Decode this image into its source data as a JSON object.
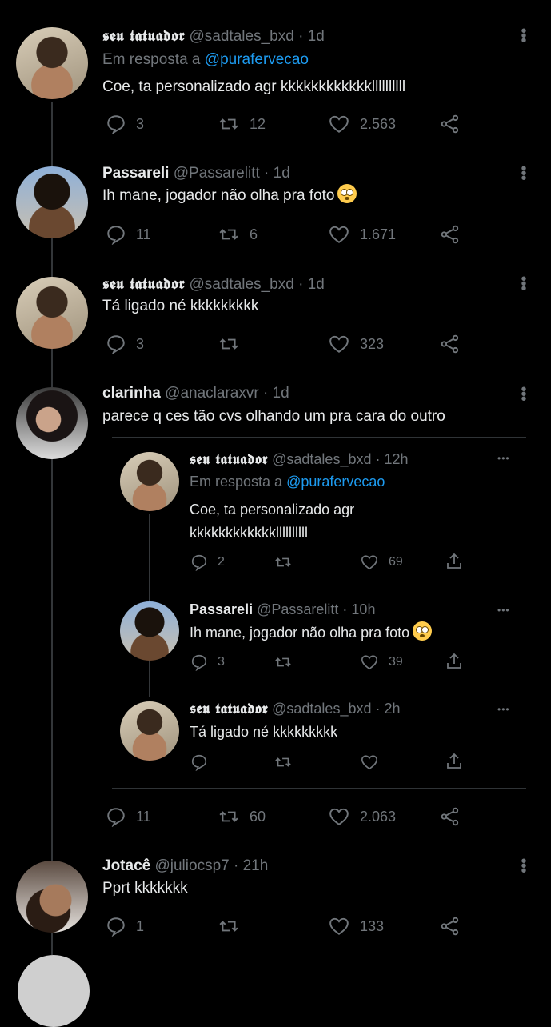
{
  "colors": {
    "background": "#000000",
    "text": "#e7e9ea",
    "muted": "#71767b",
    "link": "#1d9bf0"
  },
  "tweets": [
    {
      "name": "𝖘𝖊𝖚 𝖙𝖆𝖙𝖚𝖆𝖉𝖔𝖗",
      "handle": "@sadtales_bxd",
      "time": "· 1d",
      "reply_prefix": "Em resposta a",
      "reply_to": "@purafervecao",
      "text": "Coe, ta personalizado agr kkkkkkkkkkkkllllllllll",
      "replies": "3",
      "retweets": "12",
      "likes": "2.563"
    },
    {
      "name": "Passareli",
      "handle": "@Passarelitt",
      "time": "· 1d",
      "text": "Ih mane, jogador não olha pra foto",
      "emoji": "flushed-face",
      "replies": "11",
      "retweets": "6",
      "likes": "1.671"
    },
    {
      "name": "𝖘𝖊𝖚 𝖙𝖆𝖙𝖚𝖆𝖉𝖔𝖗",
      "handle": "@sadtales_bxd",
      "time": "· 1d",
      "text": "Tá ligado né kkkkkkkkk",
      "replies": "3",
      "retweets": "",
      "likes": "323"
    },
    {
      "name": "clarinha",
      "handle": "@anaclaraxvr",
      "time": "· 1d",
      "text": "parece q ces tão cvs olhando um pra cara do outro",
      "replies": "11",
      "retweets": "60",
      "likes": "2.063"
    },
    {
      "name": "Jotacê",
      "handle": "@juliocsp7",
      "time": "· 21h",
      "text": "Pprt kkkkkkk",
      "replies": "1",
      "retweets": "",
      "likes": "133"
    }
  ],
  "quoted": [
    {
      "name": "𝖘𝖊𝖚 𝖙𝖆𝖙𝖚𝖆𝖉𝖔𝖗",
      "handle": "@sadtales_bxd",
      "time": "· 12h",
      "reply_prefix": "Em resposta a",
      "reply_to": "@purafervecao",
      "text_line1": "Coe, ta personalizado agr",
      "text_line2": "kkkkkkkkkkkkllllllllll",
      "replies": "2",
      "likes": "69"
    },
    {
      "name": "Passareli",
      "handle": "@Passarelitt",
      "time": "· 10h",
      "text": "Ih mane, jogador não olha pra foto",
      "emoji": "flushed-face",
      "replies": "3",
      "likes": "39"
    },
    {
      "name": "𝖘𝖊𝖚 𝖙𝖆𝖙𝖚𝖆𝖉𝖔𝖗",
      "handle": "@sadtales_bxd",
      "time": "· 2h",
      "text": "Tá ligado né kkkkkkkkk",
      "replies": "",
      "likes": ""
    }
  ],
  "more_icon": "⋮",
  "more_icon_h": "•••"
}
